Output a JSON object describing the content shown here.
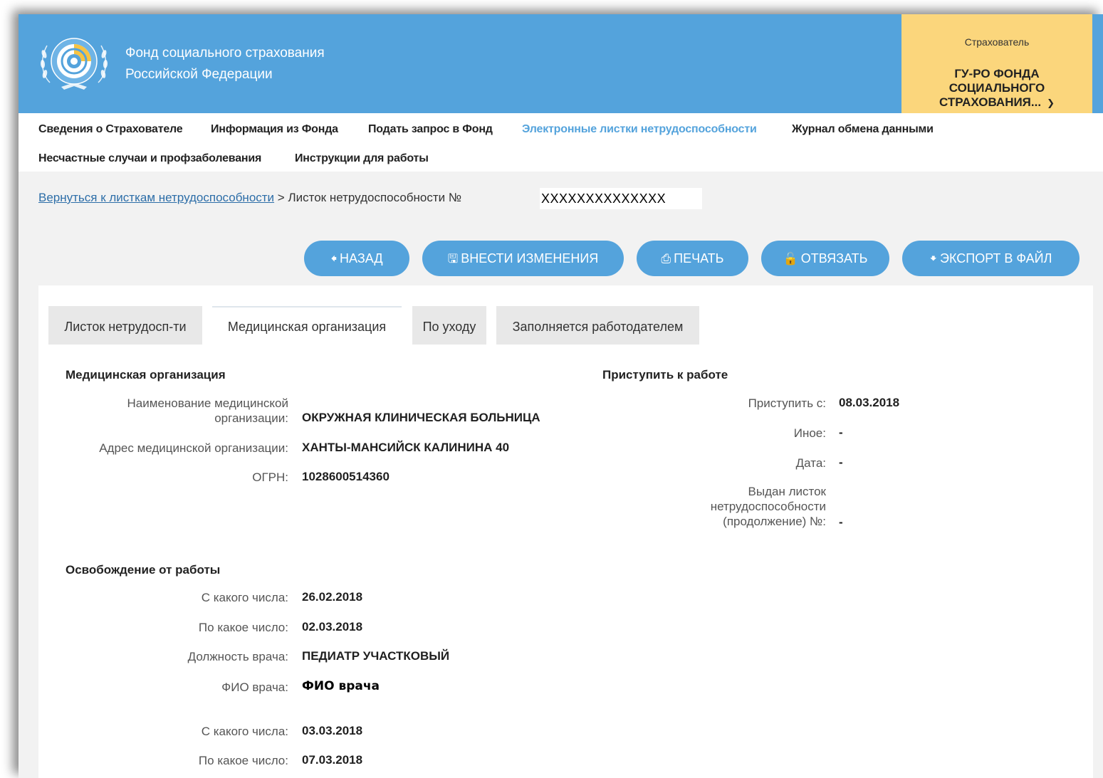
{
  "header": {
    "org_line1": "Фонд социального страхования",
    "org_line2": "Российской Федерации",
    "insurer_label": "Страхователь",
    "insurer_name_line1": "ГУ-РО ФОНДА",
    "insurer_name_line2": "СОЦИАЛЬНОГО",
    "insurer_name_line3": "СТРАХОВАНИЯ...",
    "accent_color": "#54a3dc",
    "insurer_color": "#fbd67c"
  },
  "nav": {
    "items": [
      "Сведения о Страхователе",
      "Информация из Фонда",
      "Подать запрос в Фонд",
      "Электронные листки нетрудоспособности",
      "Журнал обмена данными",
      "Несчастные случаи и профзаболевания",
      "Инструкции для работы"
    ],
    "active_index": 3
  },
  "breadcrumb": {
    "back_link": "Вернуться к листкам нетрудоспособности",
    "separator": ">",
    "current": "Листок нетрудоспособности №",
    "number": "XXXXXXXXXXXXXX"
  },
  "toolbar": {
    "back": "НАЗАД",
    "edit": "ВНЕСТИ ИЗМЕНЕНИЯ",
    "print": "ПЕЧАТЬ",
    "unlink": "ОТВЯЗАТЬ",
    "export": "ЭКСПОРТ В ФАЙЛ"
  },
  "tabs": [
    "Листок нетрудосп-ти",
    "Медицинская организация",
    "По уходу",
    "Заполняется работодателем"
  ],
  "active_tab": 1,
  "medical_org": {
    "title": "Медицинская организация",
    "name_label_1": "Наименование медицинской",
    "name_label_2": "организации:",
    "name_value": "ОКРУЖНАЯ КЛИНИЧЕСКАЯ БОЛЬНИЦА",
    "address_label": "Адрес медицинской организации:",
    "address_value": "ХАНТЫ-МАНСИЙСК КАЛИНИНА 40",
    "ogrn_label": "ОГРН:",
    "ogrn_value": "1028600514360"
  },
  "return_to_work": {
    "title": "Приступить к работе",
    "start_label": "Приступить с:",
    "start_value": "08.03.2018",
    "other_label": "Иное:",
    "other_value": "-",
    "date_label": "Дата:",
    "date_value": "-",
    "issued_label_1": "Выдан листок",
    "issued_label_2": "нетрудоспособности",
    "issued_label_3": "(продолжение) №:",
    "issued_value": "-"
  },
  "release": {
    "title": "Освобождение от работы",
    "periods": [
      {
        "from_label": "С какого числа:",
        "from_value": "26.02.2018",
        "to_label": "По какое число:",
        "to_value": "02.03.2018",
        "position_label": "Должность врача:",
        "position_value": "ПЕДИАТР УЧАСТКОВЫЙ",
        "doctor_label": "ФИО врача:",
        "doctor_value": "ФИО врача"
      },
      {
        "from_label": "С какого числа:",
        "from_value": "03.03.2018",
        "to_label": "По какое число:",
        "to_value": "07.03.2018"
      }
    ]
  }
}
